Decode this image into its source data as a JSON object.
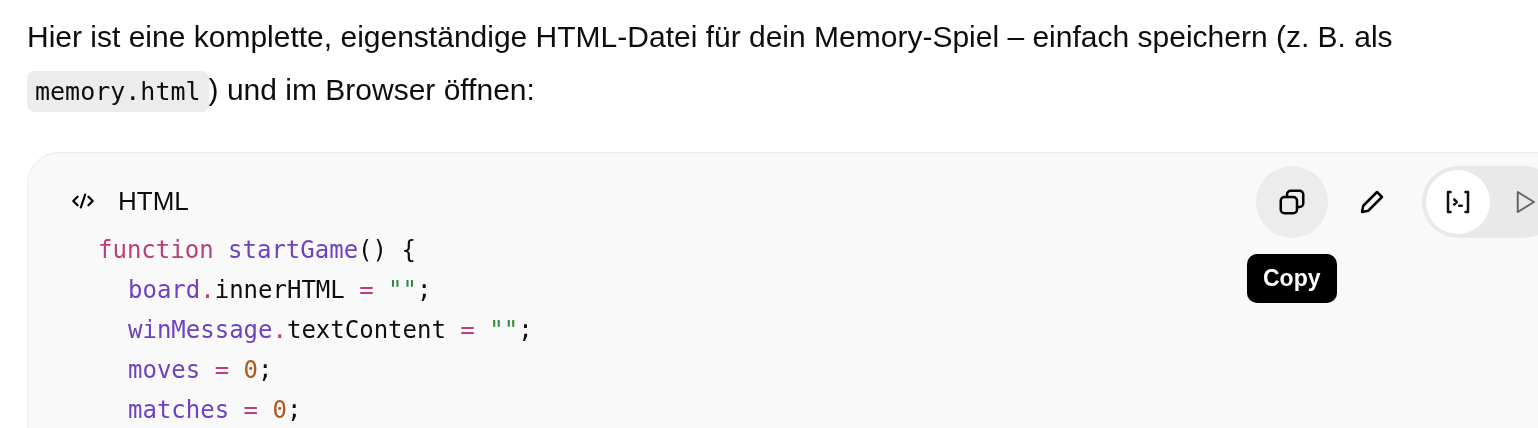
{
  "message": {
    "before": "Hier ist eine komplette, eigenständige HTML-Datei für dein Memory-Spiel – einfach speichern (z. B. als",
    "code": "memory.html",
    "after": ") und im Browser öffnen:"
  },
  "code_block": {
    "language": "HTML",
    "actions": [
      {
        "kind": "copy",
        "hovered": true
      },
      {
        "kind": "edit",
        "hovered": false
      }
    ],
    "view_toggle": [
      {
        "kind": "console",
        "selected": true
      },
      {
        "kind": "run",
        "selected": false
      }
    ],
    "tooltip": "Copy",
    "lines": [
      {
        "tokens": [
          {
            "kind": "keyword",
            "t": "function "
          },
          {
            "kind": "name",
            "t": "startGame"
          },
          {
            "t": "() {"
          }
        ],
        "children": [
          {
            "tokens": [
              {
                "kind": "name",
                "t": "board"
              },
              {
                "kind": "op",
                "t": "."
              },
              {
                "t": "innerHTML "
              },
              {
                "kind": "op",
                "t": "= "
              },
              {
                "kind": "string",
                "t": "\"\""
              },
              {
                "t": ";"
              }
            ]
          },
          {
            "tokens": [
              {
                "kind": "name",
                "t": "winMessage"
              },
              {
                "kind": "op",
                "t": "."
              },
              {
                "t": "textContent "
              },
              {
                "kind": "op",
                "t": "= "
              },
              {
                "kind": "string",
                "t": "\"\""
              },
              {
                "t": ";"
              }
            ]
          },
          {
            "tokens": [
              {
                "kind": "name",
                "t": "moves "
              },
              {
                "kind": "op",
                "t": "= "
              },
              {
                "kind": "number",
                "t": "0"
              },
              {
                "t": ";"
              }
            ]
          },
          {
            "tokens": [
              {
                "kind": "name",
                "t": "matches "
              },
              {
                "kind": "op",
                "t": "= "
              },
              {
                "kind": "number",
                "t": "0"
              },
              {
                "t": ";"
              }
            ]
          }
        ]
      }
    ]
  }
}
